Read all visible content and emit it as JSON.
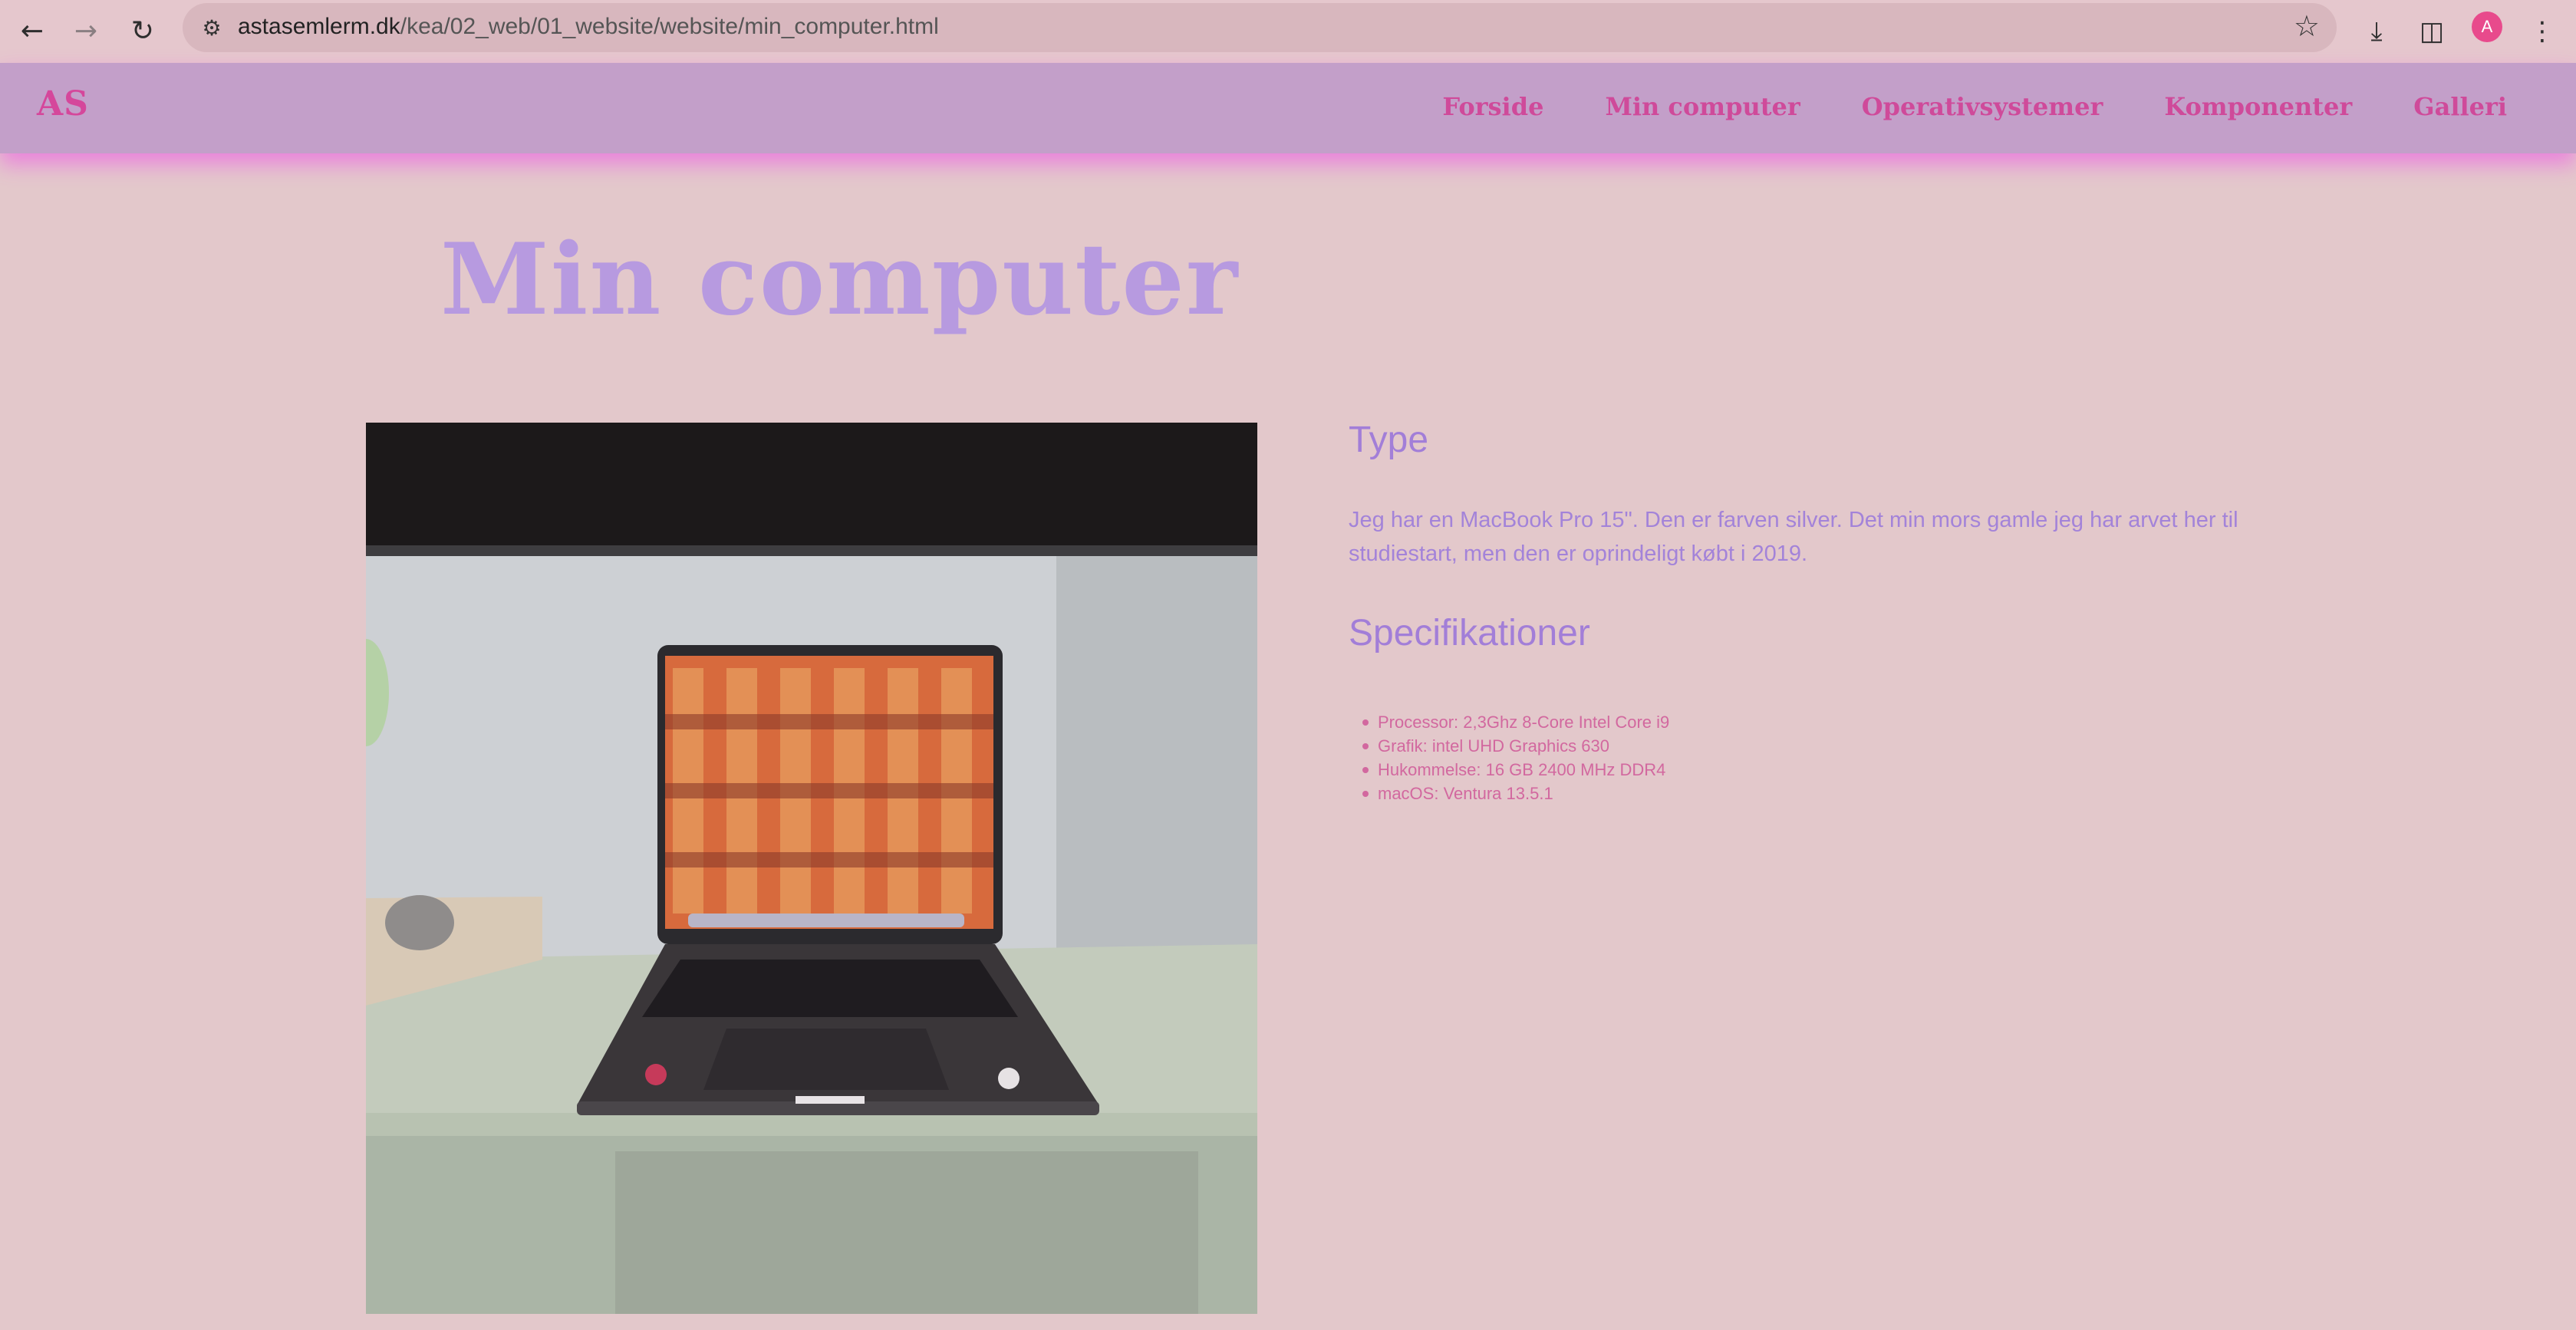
{
  "browser": {
    "url_host": "astasemlerm.dk",
    "url_path": "/kea/02_web/01_website/website/min_computer.html",
    "profile_initial": "A"
  },
  "site": {
    "logo": "AS",
    "nav": [
      "Forside",
      "Min computer",
      "Operativsystemer",
      "Komponenter",
      "Galleri"
    ]
  },
  "page": {
    "title": "Min computer",
    "type_heading": "Type",
    "type_text": "Jeg har en MacBook Pro 15\". Den er farven silver. Det min mors gamle jeg har arvet her til studiestart, men den er oprindeligt købt i 2019.",
    "spec_heading": "Specifikationer",
    "specs": [
      "Processor: 2,3Ghz 8-Core Intel Core i9",
      "Grafik: intel UHD Graphics 630",
      "Hukommelse: 16 GB 2400 MHz DDR4",
      "macOS: Ventura 13.5.1"
    ]
  },
  "colors": {
    "page_bg": "#e3c8cb",
    "header_bg": "#c39fc9",
    "accent_pink": "#cf4a9a",
    "title_lavender": "#b79ae0",
    "text_purple": "#a383d9"
  },
  "icons": [
    "back-icon",
    "forward-icon",
    "reload-icon",
    "site-info-icon",
    "star-icon",
    "download-icon",
    "sidebar-icon",
    "menu-dots-icon"
  ]
}
